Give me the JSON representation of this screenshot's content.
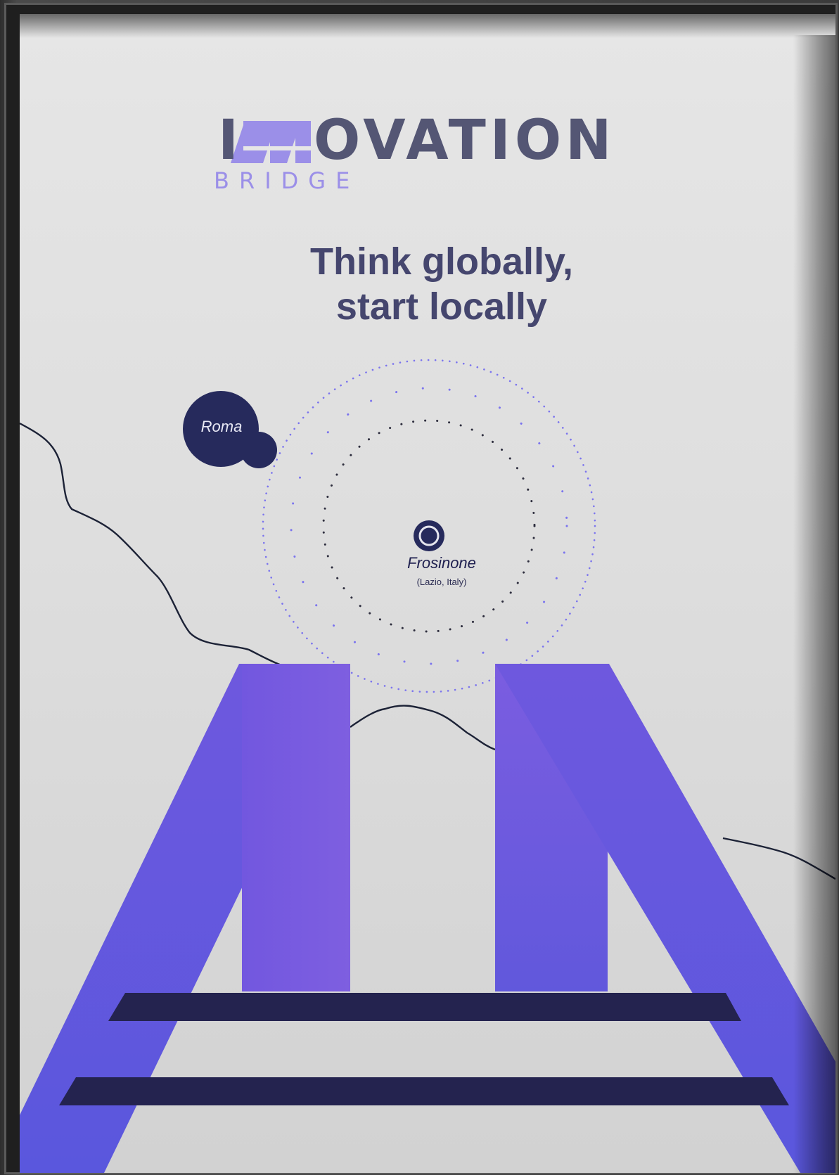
{
  "brand": {
    "initial": "I",
    "wordmark": "OVATION",
    "sub": "BRIDGE",
    "logo_text": "INNOVATION"
  },
  "headline": {
    "line1": "Think globally,",
    "line2": "start locally"
  },
  "map": {
    "roma_label": "Roma",
    "city_name": "Frosinone",
    "city_region": "(Lazio, Italy)"
  },
  "colors": {
    "logo_gray": "#545674",
    "logo_purple": "#9b8fe8",
    "headline": "#45466e",
    "pillar_purple": "#6f5ae0",
    "pillar_blue": "#5b57dc",
    "navy": "#24234f",
    "bubble_navy": "#262a5c",
    "dots_outer": "#7b74ee",
    "dots_inner": "#2e2e3e",
    "coastline": "#1c2236"
  },
  "icons": {
    "location": "target-icon",
    "logo_mark": "bridge-nn-icon"
  }
}
